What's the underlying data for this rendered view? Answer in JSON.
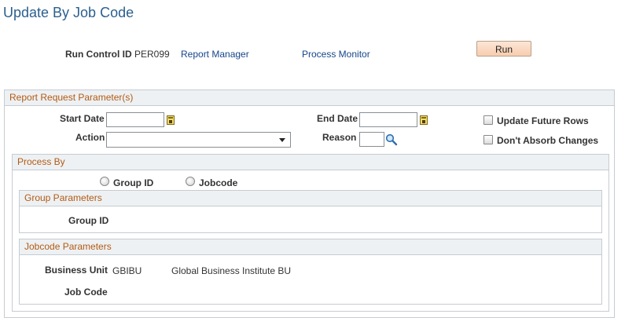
{
  "page": {
    "title": "Update By Job Code"
  },
  "run_control": {
    "label": "Run Control ID",
    "value": "PER099",
    "report_manager_link": "Report Manager",
    "process_monitor_link": "Process Monitor",
    "run_button": "Run"
  },
  "report_params": {
    "header": "Report Request Parameter(s)",
    "start_date_label": "Start Date",
    "start_date_value": "",
    "end_date_label": "End Date",
    "end_date_value": "",
    "action_label": "Action",
    "action_value": "",
    "reason_label": "Reason",
    "reason_value": "",
    "update_future_rows_label": "Update Future Rows",
    "update_future_rows_checked": false,
    "dont_absorb_label": "Don't Absorb Changes",
    "dont_absorb_checked": false
  },
  "process_by": {
    "header": "Process By",
    "group_id_option": "Group ID",
    "jobcode_option": "Jobcode",
    "selected": null
  },
  "group_params": {
    "header": "Group Parameters",
    "group_id_label": "Group ID",
    "group_id_value": ""
  },
  "jobcode_params": {
    "header": "Jobcode Parameters",
    "business_unit_label": "Business Unit",
    "business_unit_value": "GBIBU",
    "business_unit_desc": "Global Business Institute BU",
    "job_code_label": "Job Code",
    "job_code_value": ""
  },
  "icons": {
    "calendar": "calendar-icon",
    "lookup": "lookup-magnifier-icon",
    "dropdown": "chevron-down-icon"
  },
  "colors": {
    "title": "#2b5f8f",
    "link": "#15458a",
    "section_header_text": "#b25a14",
    "section_header_bg": "#eef1f3",
    "run_button_bg": "#f7cdae"
  }
}
